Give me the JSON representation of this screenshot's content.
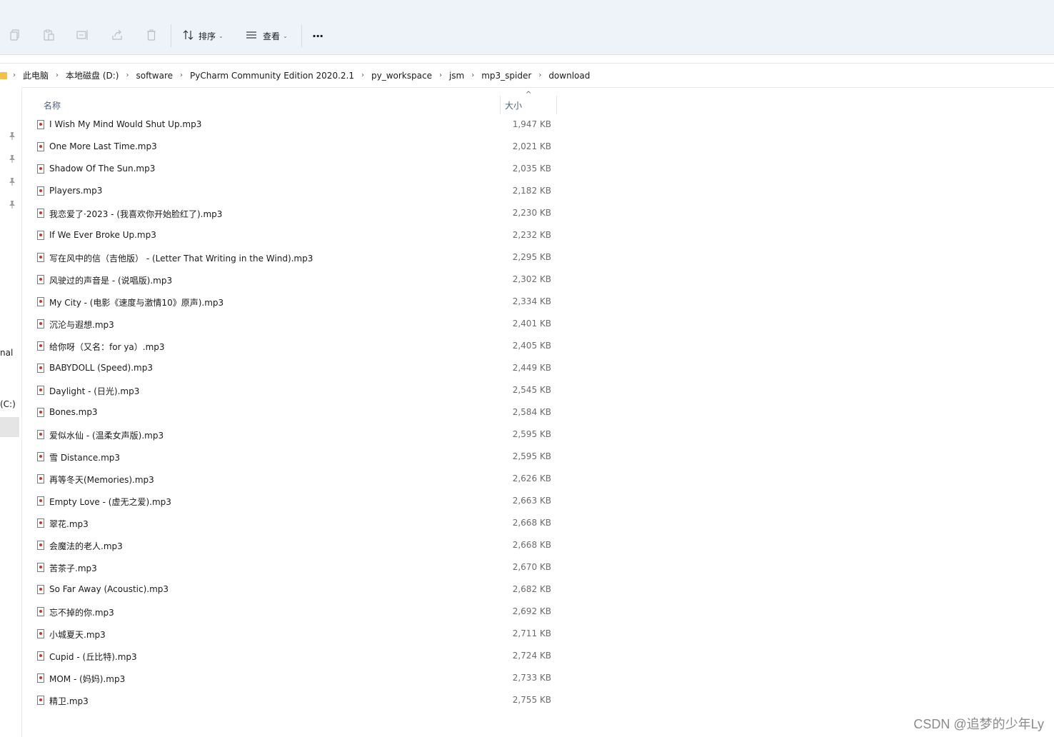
{
  "toolbar": {
    "sort_label": "排序",
    "view_label": "查看",
    "more_label": "···",
    "icons": [
      "copy-icon",
      "paste-icon",
      "rename-icon",
      "share-icon",
      "delete-icon"
    ]
  },
  "breadcrumbs": [
    "此电脑",
    "本地磁盘 (D:)",
    "software",
    "PyCharm Community Edition 2020.2.1",
    "py_workspace",
    "jsm",
    "mp3_spider",
    "download"
  ],
  "left_panel": {
    "text1": "nal",
    "text2": "(C:)"
  },
  "columns": {
    "name": "名称",
    "size": "大小"
  },
  "files": [
    {
      "name": "I Wish My Mind Would Shut Up.mp3",
      "size": "1,947 KB"
    },
    {
      "name": "One More Last Time.mp3",
      "size": "2,021 KB"
    },
    {
      "name": "Shadow Of The Sun.mp3",
      "size": "2,035 KB"
    },
    {
      "name": "Players.mp3",
      "size": "2,182 KB"
    },
    {
      "name": "我恋爱了·2023 - (我喜欢你开始脸红了).mp3",
      "size": "2,230 KB"
    },
    {
      "name": "If We Ever Broke Up.mp3",
      "size": "2,232 KB"
    },
    {
      "name": "写在风中的信（吉他版） - (Letter That Writing in the Wind).mp3",
      "size": "2,295 KB"
    },
    {
      "name": "风驶过的声音是 - (说唱版).mp3",
      "size": "2,302 KB"
    },
    {
      "name": "My City - (电影《速度与激情10》原声).mp3",
      "size": "2,334 KB"
    },
    {
      "name": "沉沦与遐想.mp3",
      "size": "2,401 KB"
    },
    {
      "name": "给你呀（又名：for ya）.mp3",
      "size": "2,405 KB"
    },
    {
      "name": "BABYDOLL (Speed).mp3",
      "size": "2,449 KB"
    },
    {
      "name": "Daylight - (日光).mp3",
      "size": "2,545 KB"
    },
    {
      "name": "Bones.mp3",
      "size": "2,584 KB"
    },
    {
      "name": "爱似水仙 - (温柔女声版).mp3",
      "size": "2,595 KB"
    },
    {
      "name": "雪 Distance.mp3",
      "size": "2,595 KB"
    },
    {
      "name": "再等冬天(Memories).mp3",
      "size": "2,626 KB"
    },
    {
      "name": "Empty Love - (虚无之爱).mp3",
      "size": "2,663 KB"
    },
    {
      "name": "翠花.mp3",
      "size": "2,668 KB"
    },
    {
      "name": "会魔法的老人.mp3",
      "size": "2,668 KB"
    },
    {
      "name": "苦茶子.mp3",
      "size": "2,670 KB"
    },
    {
      "name": "So Far Away (Acoustic).mp3",
      "size": "2,682 KB"
    },
    {
      "name": "忘不掉的你.mp3",
      "size": "2,692 KB"
    },
    {
      "name": "小城夏天.mp3",
      "size": "2,711 KB"
    },
    {
      "name": "Cupid - (丘比特).mp3",
      "size": "2,724 KB"
    },
    {
      "name": "MOM - (妈妈).mp3",
      "size": "2,733 KB"
    },
    {
      "name": "精卫.mp3",
      "size": "2,755 KB"
    }
  ],
  "watermark": "CSDN @追梦的少年Ly"
}
